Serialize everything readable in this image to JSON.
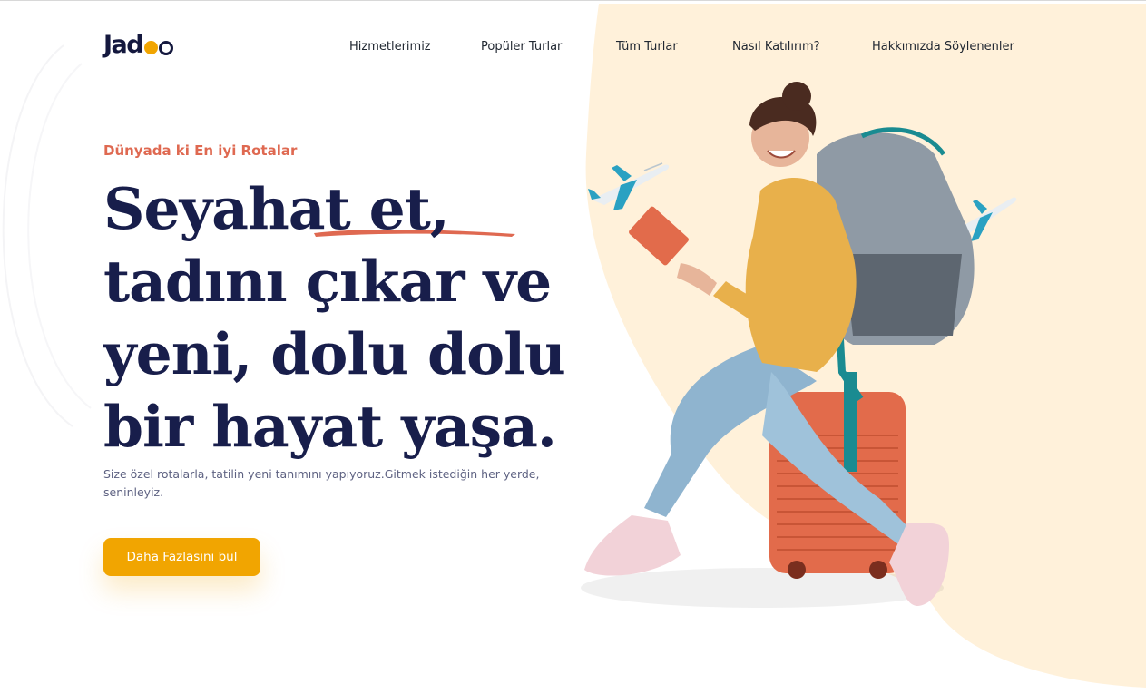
{
  "brand": {
    "logo_prefix": "Jad",
    "colors": {
      "navy": "#181E4B",
      "accent_orange": "#DF6951",
      "button_yellow": "#F1A501",
      "blob_cream": "#FFF1DA",
      "text_muted": "#5E6282"
    }
  },
  "nav": {
    "items": [
      {
        "label": "Hizmetlerimiz"
      },
      {
        "label": "Popüler Turlar"
      },
      {
        "label": "Tüm Turlar"
      },
      {
        "label": "Nasıl Katılırım?"
      },
      {
        "label": "Hakkımızda Söylenenler"
      }
    ]
  },
  "hero": {
    "tagline": "Dünyada ki En iyi Rotalar",
    "title_lines": [
      "Seyahat et,",
      "tadını çıkar ve",
      "yeni, dolu dolu",
      "bir hayat yaşa."
    ],
    "description": "Size özel rotalarla, tatilin yeni tanımını yapıyoruz.Gitmek istediğin her yerde, seninleyiz.",
    "cta_label": "Daha Fazlasını bul",
    "image_icons": [
      "plane-icon",
      "plane-icon",
      "traveler-illustration"
    ]
  }
}
